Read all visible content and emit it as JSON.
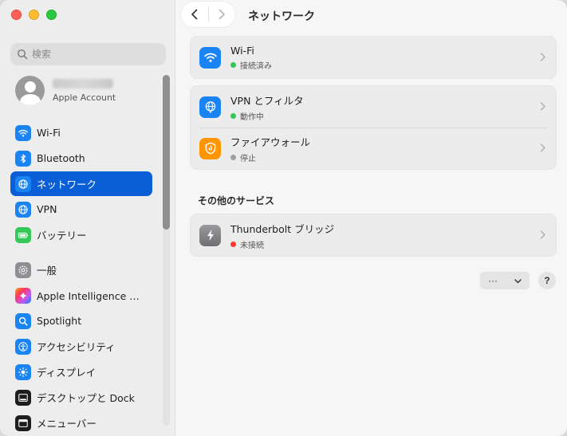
{
  "window": {
    "traffic_lights": [
      "close",
      "minimize",
      "zoom"
    ]
  },
  "sidebar": {
    "search_placeholder": "検索",
    "account": {
      "sub": "Apple Account"
    },
    "items": [
      {
        "label": "Wi-Fi",
        "icon": "wifi-icon",
        "color": "#1a84f5"
      },
      {
        "label": "Bluetooth",
        "icon": "bluetooth-icon",
        "color": "#1a84f5"
      },
      {
        "label": "ネットワーク",
        "icon": "globe-icon",
        "color": "#1a84f5",
        "active": true
      },
      {
        "label": "VPN",
        "icon": "globe-icon",
        "color": "#1a84f5"
      },
      {
        "label": "バッテリー",
        "icon": "battery-icon",
        "color": "#34c759"
      },
      {
        "label": "一般",
        "icon": "gear-icon",
        "color": "#8e8e93"
      },
      {
        "label": "Apple Intelligence と…",
        "icon": "sparkle-icon",
        "color": "#ff9f0a"
      },
      {
        "label": "Spotlight",
        "icon": "magnifier-icon",
        "color": "#1a84f5"
      },
      {
        "label": "アクセシビリティ",
        "icon": "accessibility-icon",
        "color": "#1a84f5"
      },
      {
        "label": "ディスプレイ",
        "icon": "sun-icon",
        "color": "#1a84f5"
      },
      {
        "label": "デスクトップと Dock",
        "icon": "dock-icon",
        "color": "#1d1d1f"
      },
      {
        "label": "メニューバー",
        "icon": "menubar-icon",
        "color": "#1d1d1f"
      }
    ]
  },
  "main": {
    "title": "ネットワーク",
    "services": [
      {
        "title": "Wi-Fi",
        "status": "接続済み",
        "status_color": "#34c759",
        "icon": "wifi-icon",
        "color": "#1a84f5"
      }
    ],
    "group2": [
      {
        "title": "VPN とフィルタ",
        "status": "動作中",
        "status_color": "#34c759",
        "icon": "globe-icon",
        "color": "#1a84f5"
      },
      {
        "title": "ファイアウォール",
        "status": "停止",
        "status_color": "#a0a0a0",
        "icon": "firewall-icon",
        "color": "#ff9500"
      }
    ],
    "other_section_title": "その他のサービス",
    "other": [
      {
        "title": "Thunderbolt ブリッジ",
        "status": "未接続",
        "status_color": "#ff3b30",
        "icon": "thunderbolt-icon",
        "color": "#8e8e93"
      }
    ],
    "more_button": "···",
    "more_chevron": "⌄",
    "help_button": "?"
  }
}
